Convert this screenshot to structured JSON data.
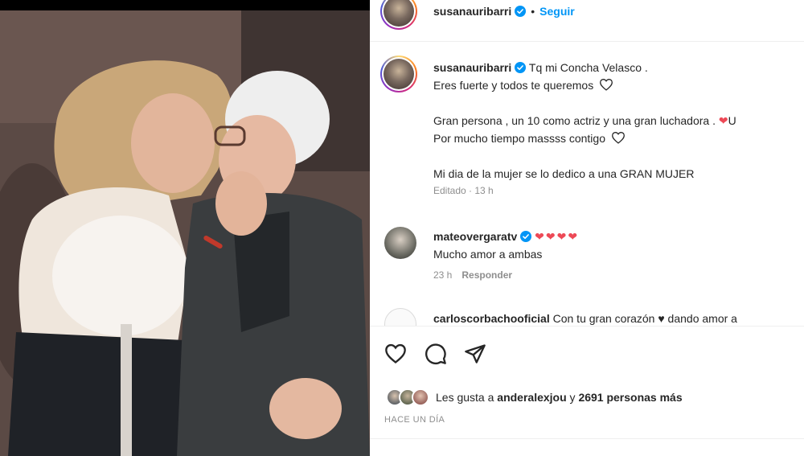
{
  "header": {
    "username": "susanauribarri",
    "separator": "•",
    "follow_label": "Seguir"
  },
  "caption": {
    "username": "susanauribarri",
    "line1": "Tq mi Concha Velasco .",
    "line2": "Eres fuerte y todos te queremos",
    "line3": "Gran persona , un 10 como actriz y una gran luchadora .",
    "line3_tail": "U",
    "line4": "Por mucho tiempo massss contigo",
    "line5": "Mi dia de la mujer se lo dedico a una GRAN MUJER",
    "edited": "Editado · 13 h"
  },
  "comments": [
    {
      "username": "mateovergaratv",
      "hearts": "❤❤❤❤",
      "text": "Mucho amor a ambas",
      "time": "23 h",
      "reply": "Responder"
    },
    {
      "username": "carloscorbachooficial",
      "text": "Con tu gran corazón ♥ dando amor a"
    }
  ],
  "likes": {
    "prefix": "Les gusta a",
    "user": "anderalexjou",
    "connector": "y",
    "count": "2691 personas más"
  },
  "timestamp": "HACE UN DÍA",
  "icons": {
    "like": "heart-outline-icon",
    "comment": "comment-bubble-icon",
    "share": "paper-plane-icon",
    "verified": "verified-badge-icon"
  },
  "colors": {
    "accent": "#0095f6",
    "heart": "#ed4956",
    "secondary_text": "#8e8e8e"
  }
}
